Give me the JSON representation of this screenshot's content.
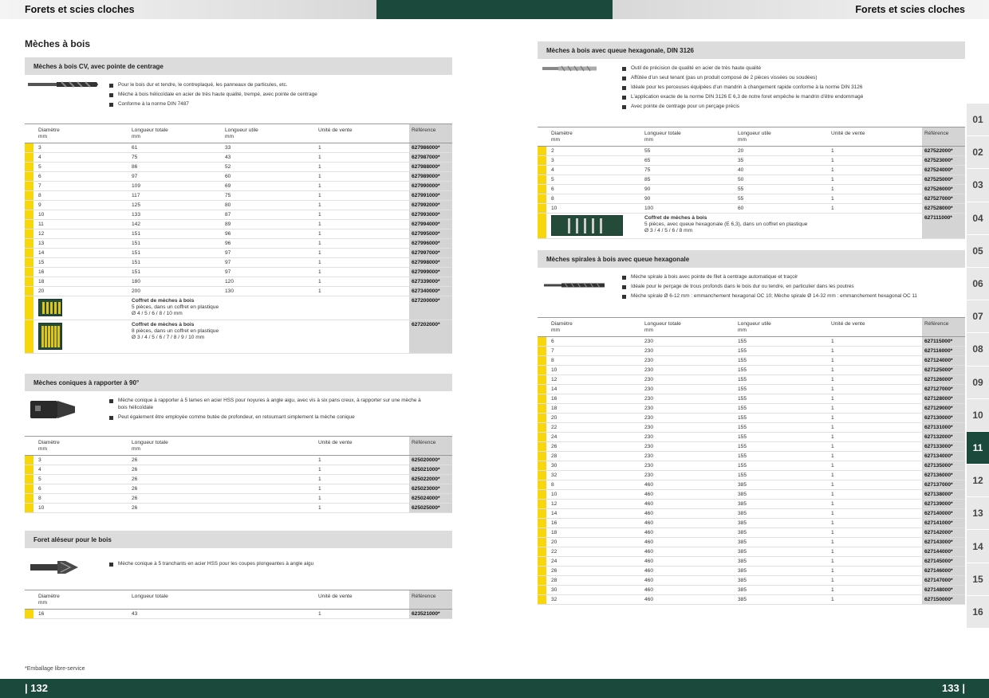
{
  "header": {
    "left_title": "Forets et scies cloches",
    "right_title": "Forets et scies cloches"
  },
  "footer": {
    "left_page": "| 132",
    "right_page": "133 |",
    "footnote": "*Emballage libre-service"
  },
  "left_title": "Mèches à bois",
  "tabs": [
    "01",
    "02",
    "03",
    "04",
    "05",
    "06",
    "07",
    "08",
    "09",
    "10",
    "11",
    "12",
    "13",
    "14",
    "15",
    "16"
  ],
  "active_tab": "11",
  "sections": {
    "cv": {
      "title": "Mèches à bois CV, avec pointe de centrage",
      "bullets": [
        "Pour le bois dur et tendre, le contreplaqué, les panneaux de particules, etc.",
        "Mèche à bois hélicoïdale en acier de très haute qualité, trempé, avec pointe de centrage",
        "Conforme à la norme DIN 7487"
      ],
      "headers": [
        "Diamètre",
        "mm",
        "Longueur totale",
        "mm",
        "Longueur utile",
        "mm",
        "Unité de vente",
        "Référence"
      ],
      "rows": [
        [
          "3",
          "61",
          "33",
          "1",
          "627986000*"
        ],
        [
          "4",
          "75",
          "43",
          "1",
          "627987000*"
        ],
        [
          "5",
          "86",
          "52",
          "1",
          "627988000*"
        ],
        [
          "6",
          "97",
          "60",
          "1",
          "627989000*"
        ],
        [
          "7",
          "109",
          "69",
          "1",
          "627990000*"
        ],
        [
          "8",
          "117",
          "75",
          "1",
          "627991000*"
        ],
        [
          "9",
          "125",
          "80",
          "1",
          "627992000*"
        ],
        [
          "10",
          "133",
          "87",
          "1",
          "627993000*"
        ],
        [
          "11",
          "142",
          "89",
          "1",
          "627994000*"
        ],
        [
          "12",
          "151",
          "96",
          "1",
          "627995000*"
        ],
        [
          "13",
          "151",
          "96",
          "1",
          "627996000*"
        ],
        [
          "14",
          "151",
          "97",
          "1",
          "627997000*"
        ],
        [
          "15",
          "151",
          "97",
          "1",
          "627998000*"
        ],
        [
          "16",
          "151",
          "97",
          "1",
          "627999000*"
        ],
        [
          "18",
          "180",
          "120",
          "1",
          "627339000*"
        ],
        [
          "20",
          "200",
          "130",
          "1",
          "627340000*"
        ]
      ],
      "kits": [
        {
          "title": "Coffret de mèches à bois",
          "line1": "5 pièces, dans un coffret en plastique",
          "line2": "Ø 4 / 5 / 6 / 8 / 10 mm",
          "ref": "627200000*"
        },
        {
          "title": "Coffret de mèches à bois",
          "line1": "8 pièces, dans un coffret en plastique",
          "line2": "Ø 3 / 4 / 5 / 6 / 7 / 8 / 9 / 10 mm",
          "ref": "627202000*"
        }
      ]
    },
    "coniques": {
      "title": "Mèches coniques à rapporter à 90°",
      "bullets": [
        "Mèche conique à rapporter à 5 lames en acier HSS pour noyures à angle aigu, avec vis à six pans creux, à rapporter sur une mèche à bois hélicoïdale",
        "Peut également être employée comme butée de profondeur, en retournant simplement la mèche conique"
      ],
      "headers": [
        "Diamètre",
        "mm",
        "Longueur totale",
        "mm",
        "Unité de vente",
        "Référence"
      ],
      "rows": [
        [
          "3",
          "26",
          "1",
          "625020000*"
        ],
        [
          "4",
          "26",
          "1",
          "625021000*"
        ],
        [
          "5",
          "26",
          "1",
          "625022000*"
        ],
        [
          "6",
          "26",
          "1",
          "625023000*"
        ],
        [
          "8",
          "26",
          "1",
          "625024000*"
        ],
        [
          "10",
          "26",
          "1",
          "625025000*"
        ]
      ]
    },
    "aleseur": {
      "title": "Foret aléseur pour le bois",
      "bullets": [
        "Mèche conique à 5 tranchants en acier HSS pour les coupes plongeantes à angle aigu"
      ],
      "headers": [
        "Diamètre",
        "mm",
        "Longueur totale",
        "Unité de vente",
        "Référence"
      ],
      "rows": [
        [
          "16",
          "43",
          "1",
          "623521000*"
        ]
      ]
    },
    "hex": {
      "title": "Mèches à bois avec queue hexagonale, DIN 3126",
      "bullets": [
        "Outil de précision de qualité en acier de très haute qualité",
        "Affûtée d'un seul tenant (pas un produit composé de 2 pièces vissées ou soudées)",
        "Idéale pour les perceuses équipées d'un mandrin à changement rapide conforme à la norme DIN 3126",
        "L'application exacte de la norme DIN 3126 E 6,3 de notre foret empêche le mandrin d'être endommagé",
        "Avec pointe de centrage pour un perçage précis"
      ],
      "headers": [
        "Diamètre",
        "mm",
        "Longueur totale",
        "mm",
        "Longueur utile",
        "mm",
        "Unité de vente",
        "Référence"
      ],
      "rows": [
        [
          "2",
          "55",
          "20",
          "1",
          "627522000*"
        ],
        [
          "3",
          "65",
          "35",
          "1",
          "627523000*"
        ],
        [
          "4",
          "75",
          "40",
          "1",
          "627524000*"
        ],
        [
          "5",
          "85",
          "50",
          "1",
          "627525000*"
        ],
        [
          "6",
          "90",
          "55",
          "1",
          "627526000*"
        ],
        [
          "8",
          "90",
          "55",
          "1",
          "627527000*"
        ],
        [
          "10",
          "100",
          "60",
          "1",
          "627528000*"
        ]
      ],
      "kit": {
        "title": "Coffret de mèches à bois",
        "line1": "5 pièces, avec queue hexagonale (E 6,3), dans un coffret en plastique",
        "line2": "Ø 3 / 4 / 5 / 6 / 8 mm",
        "ref": "627111000*"
      }
    },
    "spirales": {
      "title": "Mèches spirales à bois avec queue hexagonale",
      "bullets": [
        "Mèche spirale à bois avec pointe de filet à centrage automatique et traçoir",
        "Idéale pour le perçage de trous profonds dans le bois dur ou tendre, en particulier dans les poutres",
        "Mèche spirale Ø 6-12 mm : emmanchement hexagonal OC 10; Mèche spirale Ø 14-32 mm : emmanchement hexagonal OC 11"
      ],
      "headers": [
        "Diamètre",
        "mm",
        "Longueur totale",
        "mm",
        "Longueur utile",
        "mm",
        "Unité de vente",
        "Référence"
      ],
      "rows": [
        [
          "6",
          "230",
          "155",
          "1",
          "627115000*"
        ],
        [
          "7",
          "230",
          "155",
          "1",
          "627116000*"
        ],
        [
          "8",
          "230",
          "155",
          "1",
          "627124000*"
        ],
        [
          "10",
          "230",
          "155",
          "1",
          "627125000*"
        ],
        [
          "12",
          "230",
          "155",
          "1",
          "627126000*"
        ],
        [
          "14",
          "230",
          "155",
          "1",
          "627127000*"
        ],
        [
          "16",
          "230",
          "155",
          "1",
          "627128000*"
        ],
        [
          "18",
          "230",
          "155",
          "1",
          "627129000*"
        ],
        [
          "20",
          "230",
          "155",
          "1",
          "627130000*"
        ],
        [
          "22",
          "230",
          "155",
          "1",
          "627131000*"
        ],
        [
          "24",
          "230",
          "155",
          "1",
          "627132000*"
        ],
        [
          "26",
          "230",
          "155",
          "1",
          "627133000*"
        ],
        [
          "28",
          "230",
          "155",
          "1",
          "627134000*"
        ],
        [
          "30",
          "230",
          "155",
          "1",
          "627135000*"
        ],
        [
          "32",
          "230",
          "155",
          "1",
          "627136000*"
        ],
        [
          "8",
          "460",
          "385",
          "1",
          "627137000*"
        ],
        [
          "10",
          "460",
          "385",
          "1",
          "627138000*"
        ],
        [
          "12",
          "460",
          "385",
          "1",
          "627139000*"
        ],
        [
          "14",
          "460",
          "385",
          "1",
          "627140000*"
        ],
        [
          "16",
          "460",
          "385",
          "1",
          "627141000*"
        ],
        [
          "18",
          "460",
          "385",
          "1",
          "627142000*"
        ],
        [
          "20",
          "460",
          "385",
          "1",
          "627143000*"
        ],
        [
          "22",
          "460",
          "385",
          "1",
          "627144000*"
        ],
        [
          "24",
          "460",
          "385",
          "1",
          "627145000*"
        ],
        [
          "26",
          "460",
          "385",
          "1",
          "627146000*"
        ],
        [
          "28",
          "460",
          "385",
          "1",
          "627147000*"
        ],
        [
          "30",
          "460",
          "385",
          "1",
          "627148000*"
        ],
        [
          "32",
          "460",
          "385",
          "1",
          "627150000*"
        ]
      ]
    }
  }
}
